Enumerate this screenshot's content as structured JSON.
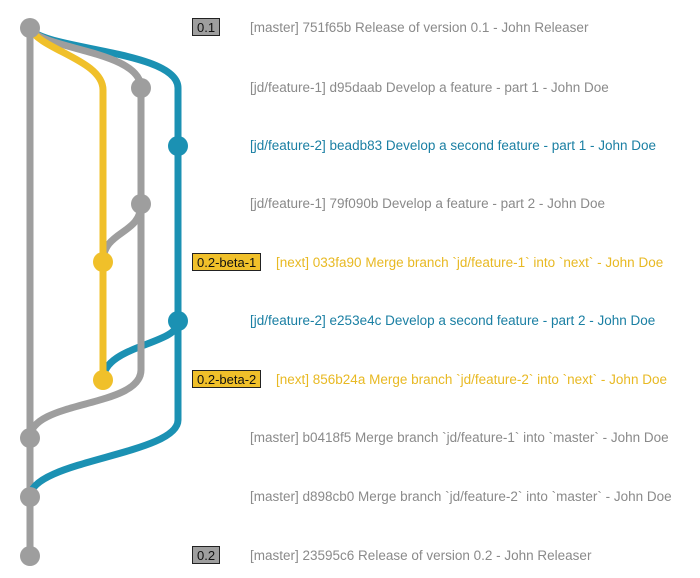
{
  "colors": {
    "master": "#9e9e9e",
    "feature1": "#9e9e9e",
    "feature2": "#1b91b3",
    "next": "#f0c02a",
    "tag_master": "#9e9e9e",
    "tag_next": "#f0c02a",
    "text_gray": "#8a8a8a",
    "text_blue": "#1a7fa3",
    "text_yellow": "#e8b923"
  },
  "commits": [
    {
      "tag": "0.1",
      "tag_style": "master",
      "text": "[master] 751f65b Release of version 0.1 - John Releaser",
      "color": "gray"
    },
    {
      "tag": "",
      "text": "[jd/feature-1] d95daab Develop a feature - part 1 - John Doe",
      "color": "gray"
    },
    {
      "tag": "",
      "text": "[jd/feature-2] beadb83 Develop a second feature - part 1 - John Doe",
      "color": "blue"
    },
    {
      "tag": "",
      "text": "[jd/feature-1] 79f090b Develop a feature - part 2 - John Doe",
      "color": "gray"
    },
    {
      "tag": "0.2-beta-1",
      "tag_style": "next",
      "text": "[next] 033fa90 Merge branch `jd/feature-1` into `next` - John Doe",
      "color": "yellow"
    },
    {
      "tag": "",
      "text": "[jd/feature-2] e253e4c Develop a second feature - part 2 - John Doe",
      "color": "blue"
    },
    {
      "tag": "0.2-beta-2",
      "tag_style": "next",
      "text": "[next] 856b24a Merge branch `jd/feature-2` into `next` - John Doe",
      "color": "yellow"
    },
    {
      "tag": "",
      "text": "[master] b0418f5 Merge branch `jd/feature-1` into `master` - John Doe",
      "color": "gray"
    },
    {
      "tag": "",
      "text": "[master] d898cb0 Merge branch `jd/feature-2` into `master` - John Doe",
      "color": "gray"
    },
    {
      "tag": "0.2",
      "tag_style": "master",
      "text": "[master] 23595c6 Release of version 0.2 - John Releaser",
      "color": "gray"
    }
  ]
}
